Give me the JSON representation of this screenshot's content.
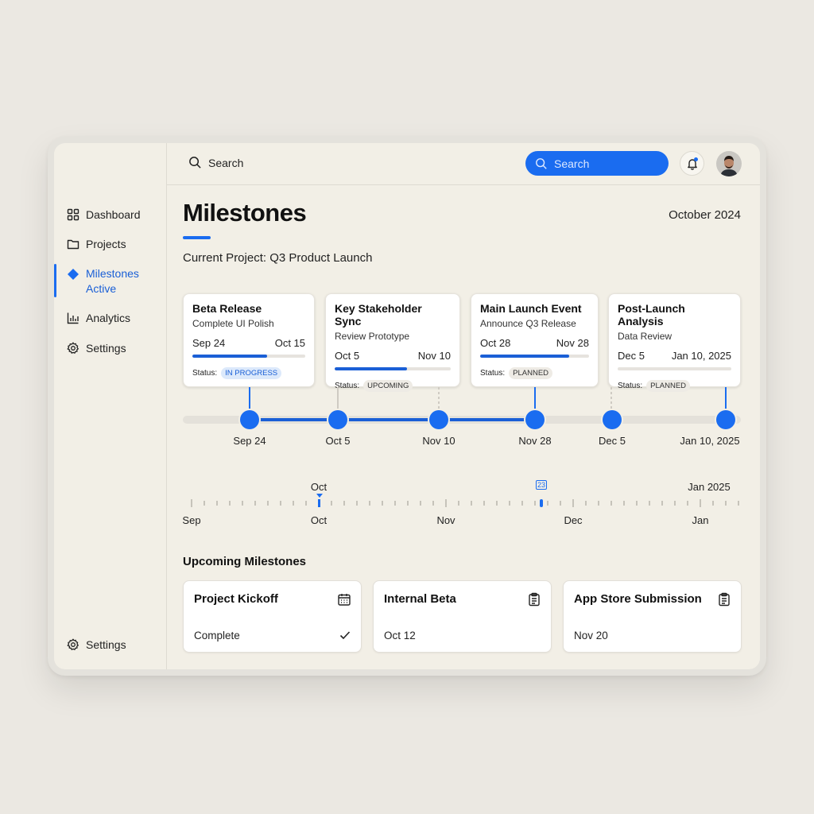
{
  "sidebar": {
    "items": [
      {
        "label": "Dashboard",
        "icon": "grid-icon"
      },
      {
        "label": "Projects",
        "icon": "folder-icon"
      },
      {
        "label": "Milestones",
        "sub": "Active",
        "icon": "diamond-icon"
      },
      {
        "label": "Analytics",
        "icon": "bar-chart-icon"
      },
      {
        "label": "Settings",
        "icon": "gear-icon"
      }
    ],
    "footer_settings": "Settings"
  },
  "topbar": {
    "search_label": "Search",
    "search_pill_label": "Search"
  },
  "page": {
    "title": "Milestones",
    "date": "October 2024",
    "project": "Current Project: Q3 Product Launch"
  },
  "milestones": [
    {
      "title": "Beta Release",
      "subtitle": "Complete UI Polish",
      "start": "Sep 24",
      "end": "Oct 15",
      "progress": 0.66,
      "status_label": "Status:",
      "status": "IN PROGRESS"
    },
    {
      "title": "Key Stakeholder Sync",
      "subtitle": "Review Prototype",
      "start": "Oct 5",
      "end": "Nov 10",
      "progress": 0.62,
      "status_label": "Status:",
      "status": "UPCOMING"
    },
    {
      "title": "Main Launch Event",
      "subtitle": "Announce Q3 Release",
      "start": "Oct 28",
      "end": "Nov 28",
      "progress": 0.82,
      "status_label": "Status:",
      "status": "PLANNED"
    },
    {
      "title": "Post-Launch Analysis",
      "subtitle": "Data Review",
      "start": "Dec 5",
      "end": "Jan 10, 2025",
      "progress": 0.0,
      "status_label": "Status:",
      "status": "PLANNED"
    }
  ],
  "timeline": {
    "nodes": [
      "Sep 24",
      "Oct 5",
      "Nov 10",
      "Nov 28",
      "Dec 5",
      "Jan 10, 2025"
    ]
  },
  "ruler": {
    "top_labels": {
      "oct": "Oct",
      "today": "23",
      "jan": "Jan 2025"
    },
    "months": [
      "Sep",
      "Oct",
      "Nov",
      "Dec",
      "Jan"
    ]
  },
  "upcoming": {
    "heading": "Upcoming Milestones",
    "items": [
      {
        "title": "Project Kickoff",
        "value": "Complete",
        "icon": "calendar-icon",
        "done": true
      },
      {
        "title": "Internal Beta",
        "value": "Oct 12",
        "icon": "clipboard-icon",
        "done": false
      },
      {
        "title": "App Store Submission",
        "value": "Nov 20",
        "icon": "clipboard-icon",
        "done": false
      }
    ]
  },
  "colors": {
    "accent": "#1a6cf0",
    "background": "#f2efe6"
  }
}
